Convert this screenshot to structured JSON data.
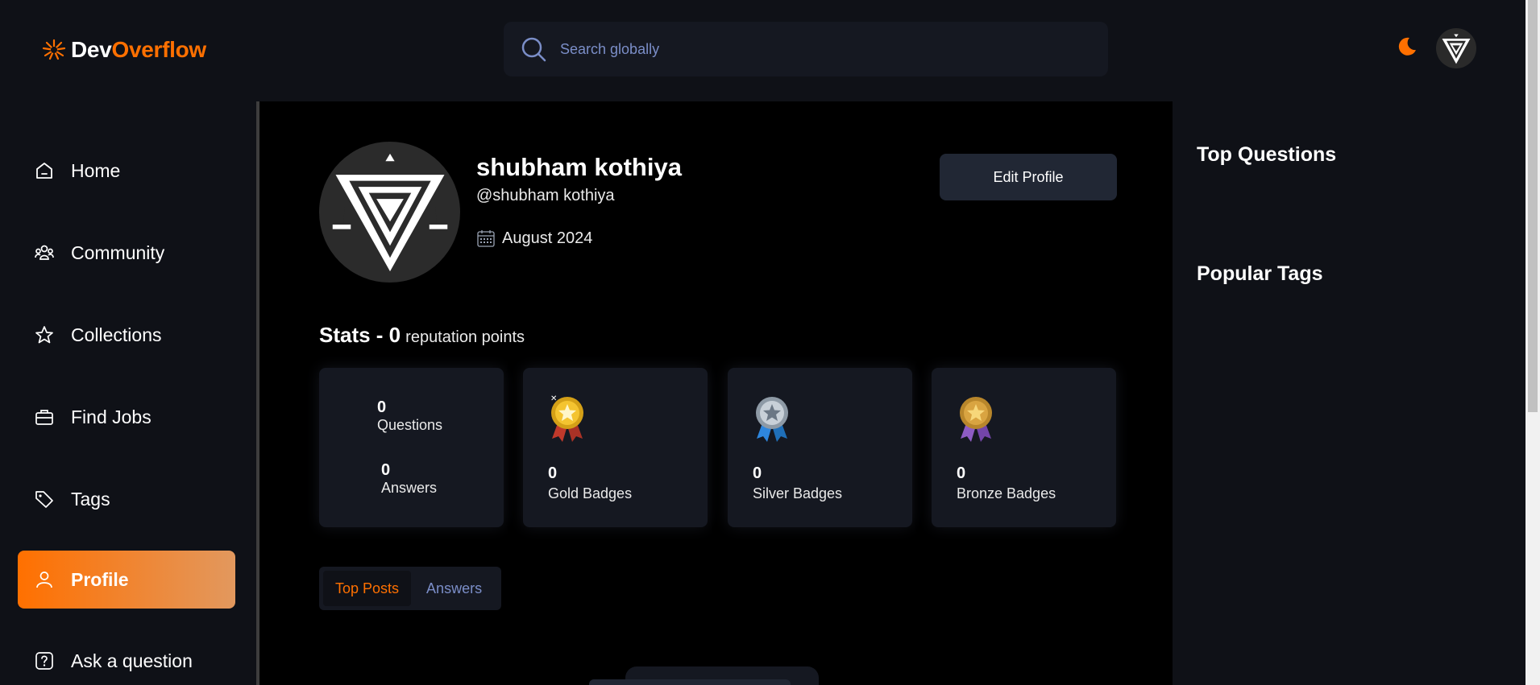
{
  "brand": {
    "prefix": "Dev",
    "suffix": "Overflow",
    "accent": "#ff7000"
  },
  "search": {
    "placeholder": "Search globally"
  },
  "sidebar": {
    "items": [
      {
        "label": "Home",
        "icon": "home-icon",
        "active": false
      },
      {
        "label": "Community",
        "icon": "users-icon",
        "active": false
      },
      {
        "label": "Collections",
        "icon": "star-icon",
        "active": false
      },
      {
        "label": "Find Jobs",
        "icon": "suitcase-icon",
        "active": false
      },
      {
        "label": "Tags",
        "icon": "tag-icon",
        "active": false
      },
      {
        "label": "Profile",
        "icon": "user-icon",
        "active": true
      },
      {
        "label": "Ask a question",
        "icon": "question-icon",
        "active": false
      }
    ]
  },
  "profile": {
    "name": "shubham kothiya",
    "username": "@shubham kothiya",
    "joined": "August 2024",
    "edit_label": "Edit Profile"
  },
  "stats": {
    "title_prefix": "Stats - 0",
    "title_suffix": "reputation points",
    "questions": {
      "value": "0",
      "label": "Questions"
    },
    "answers": {
      "value": "0",
      "label": "Answers"
    },
    "badges": [
      {
        "value": "0",
        "label": "Gold Badges",
        "icon": "gold-medal-icon"
      },
      {
        "value": "0",
        "label": "Silver Badges",
        "icon": "silver-medal-icon"
      },
      {
        "value": "0",
        "label": "Bronze Badges",
        "icon": "bronze-medal-icon"
      }
    ]
  },
  "tabs": [
    {
      "label": "Top Posts",
      "active": true
    },
    {
      "label": "Answers",
      "active": false
    }
  ],
  "right_sidebar": {
    "top_questions_title": "Top Questions",
    "popular_tags_title": "Popular Tags"
  }
}
